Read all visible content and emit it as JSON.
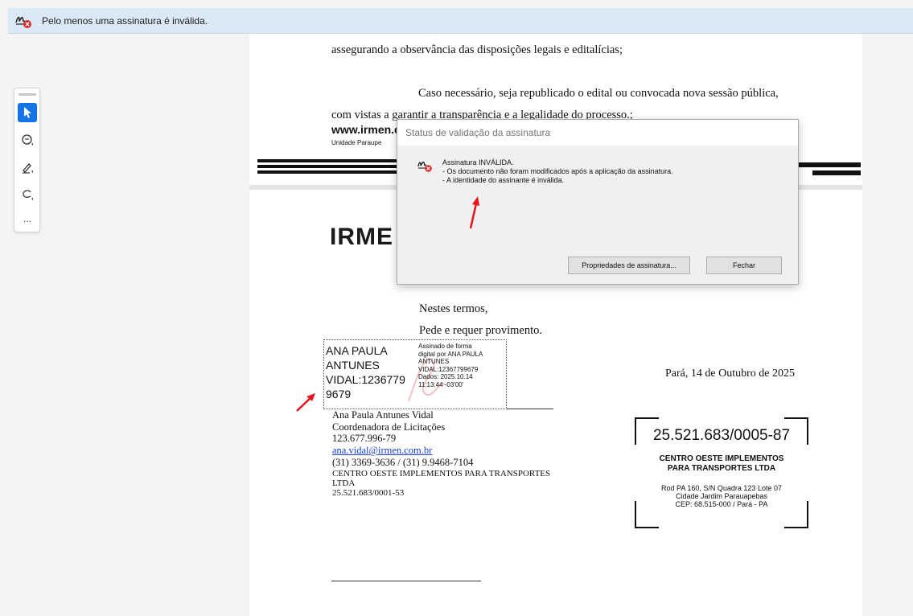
{
  "banner": {
    "message": "Pelo menos uma assinatura é inválida."
  },
  "toolbar": {
    "tools": [
      "select-tool",
      "comment-tool",
      "draw-tool",
      "sign-tool"
    ],
    "more_label": "..."
  },
  "document": {
    "page1": {
      "line1": "assegurando a observância das disposições legais e editalícias;",
      "line2": "Caso necessário, seja republicado o edital ou convocada nova sessão pública,",
      "line3": "com vistas a garantir a transparência e a legalidade do processo.;",
      "website": "www.irmen.c",
      "unit": "Unidade Paraupe"
    },
    "page2": {
      "logo": "IRME",
      "closing1": "Nestes termos,",
      "closing2": "Pede e requer provimento.",
      "date": "Pará, 14 de Outubro  de 2025",
      "signature_block": {
        "name_big": [
          "ANA PAULA",
          "ANTUNES",
          "VIDAL:1236779",
          "9679"
        ],
        "details": [
          "Assinado de forma",
          "digital por ANA PAULA",
          "ANTUNES",
          "VIDAL:12367799679",
          "Dados: 2025.10.14",
          "11:13:44 -03'00'"
        ]
      },
      "signer": {
        "name": "Ana Paula Antunes Vidal",
        "role": "Coordenadora de Licitações",
        "doc": "123.677.996-79",
        "email": "ana.vidal@irmen.com.br",
        "phone": "(31) 3369-3636 / (31) 9.9468-7104",
        "company_line1": "CENTRO OESTE IMPLEMENTOS PARA TRANSPORTES",
        "company_line2": "LTDA",
        "cnpj": "25.521.683/0001-53"
      },
      "stamp": {
        "cnpj": "25.521.683/0005-87",
        "company_line1": "CENTRO OESTE IMPLEMENTOS",
        "company_line2": "PARA TRANSPORTES LTDA",
        "address1": "Rod PA 160, S/N Quadra 123 Lote 07",
        "address2": "Cidade Jardim Parauapebas",
        "address3": "CEP: 68.515-000 / Pará - PA"
      }
    }
  },
  "dialog": {
    "title": "Status de validação da assinatura",
    "line1": "Assinatura INVÁLIDA.",
    "line2": "- Os documento não foram modificados após a aplicação da assinatura.",
    "line3": "- A identidade do assinante é inválida.",
    "properties_button": "Propriedades de assinatura...",
    "close_button": "Fechar"
  },
  "colors": {
    "banner_bg": "#dbe8f5",
    "accent": "#1473e6",
    "error": "#e0242b",
    "annotation_arrow": "#e8141c"
  }
}
